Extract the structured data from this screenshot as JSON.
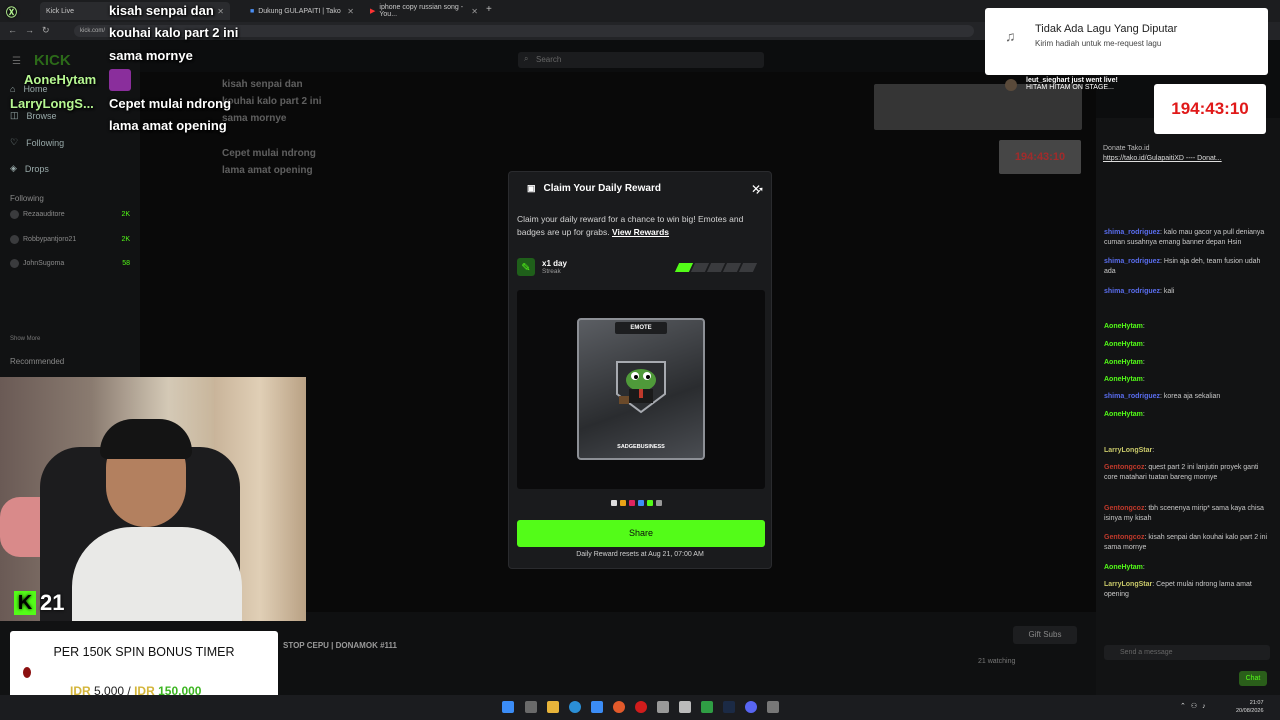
{
  "browser": {
    "tabs": [
      {
        "label": "Kick Live"
      },
      {
        "label": "Dukung GULAPAITI | Tako"
      },
      {
        "label": "iphone copy russian song - You..."
      }
    ],
    "url": "kick.com/"
  },
  "kick_page": {
    "search_placeholder": "Search",
    "sidebar": {
      "items": [
        "Home",
        "Browse",
        "Following",
        "Drops"
      ],
      "following_header": "Following",
      "following": [
        {
          "name": "Rezaauditore",
          "count": "2K"
        },
        {
          "name": "Robbypantjoro21",
          "count": "2K"
        },
        {
          "name": "JohnSugoma",
          "count": "58"
        }
      ],
      "show_more": "Show More",
      "recommended": "Recommended"
    },
    "stream_title": "STOP CEPU | DONAMOK #111",
    "gift_subs": "Gift Subs",
    "watching": "21 watching",
    "chat_input_placeholder": "Send a message",
    "chat_button": "Chat"
  },
  "stream_overlay": {
    "chat_lines": [
      {
        "text": "kisah senpai dan"
      },
      {
        "text": "kouhai kalo part 2 ini"
      },
      {
        "text": "sama mornye"
      },
      {
        "text": "Cepet mulai ndrong"
      },
      {
        "text": "lama amat opening"
      }
    ],
    "names": [
      "AoneHytam",
      "LarryLongS..."
    ],
    "viewers": "21"
  },
  "chat_messages": [
    {
      "user": "shima_rodriguez",
      "text": "kalo mau gacor ya pull denianya cuman susahnya emang banner depan Hsin"
    },
    {
      "user": "shima_rodriguez",
      "text": "Hsin aja deh, team fusion udah ada"
    },
    {
      "user": "shima_rodriguez",
      "text": "kali"
    },
    {
      "user": "AoneHytam",
      "text": ""
    },
    {
      "user": "shima_rodriguez",
      "text": "korea aja sekalian"
    },
    {
      "user": "LarryLongStar",
      "text": ""
    },
    {
      "user": "Gentongcoz",
      "text": "quest part 2 ini lanjutin proyek ganti core matahari tuatan bareng mornye"
    },
    {
      "user": "Gentongcoz",
      "text": "tbh scenenya mirip* sama kaya chisa isinya my kisah"
    },
    {
      "user": "Gentongcoz",
      "text": "kisah senpai dan kouhai kalo part 2 ini sama mornye"
    },
    {
      "user": "AoneHytam",
      "text": ""
    },
    {
      "user": "LarryLongStar",
      "text": "Cepet mulai ndrong lama amat opening"
    }
  ],
  "donate": {
    "title": "Donate Tako.id",
    "link": "https://tako.id/GulapaitiXD ---- Donat..."
  },
  "modal": {
    "title": "Claim Your Daily Reward",
    "description": "Claim your daily reward for a chance to win big! Emotes and badges are up for grabs.",
    "link_label": "View Rewards",
    "streak_days": "x1 day",
    "streak_label": "Streak",
    "streak_filled": 1,
    "streak_total": 5,
    "card_type": "EMOTE",
    "card_name": "SADGEBUSINESS",
    "share_label": "Share",
    "reset_text": "Daily Reward resets at Aug 21, 07:00 AM"
  },
  "notification": {
    "title": "Tidak Ada Lagu Yang Diputar",
    "subtitle": "Kirim hadiah untuk me-request lagu"
  },
  "live_alert": {
    "user": "leut_sieghart just went live!",
    "text": "HITAM HITAM ON STAGE..."
  },
  "timer": "194:43:10",
  "promo": {
    "headline": "PER 150K SPIN BONUS TIMER",
    "currency": "IDR",
    "current": "5.000",
    "separator": "/",
    "target": "150.000"
  },
  "clock": {
    "time": "21:07",
    "date": "20/08/2026"
  },
  "colors": {
    "kick_green": "#53fc18",
    "timer_red": "#e01919"
  }
}
